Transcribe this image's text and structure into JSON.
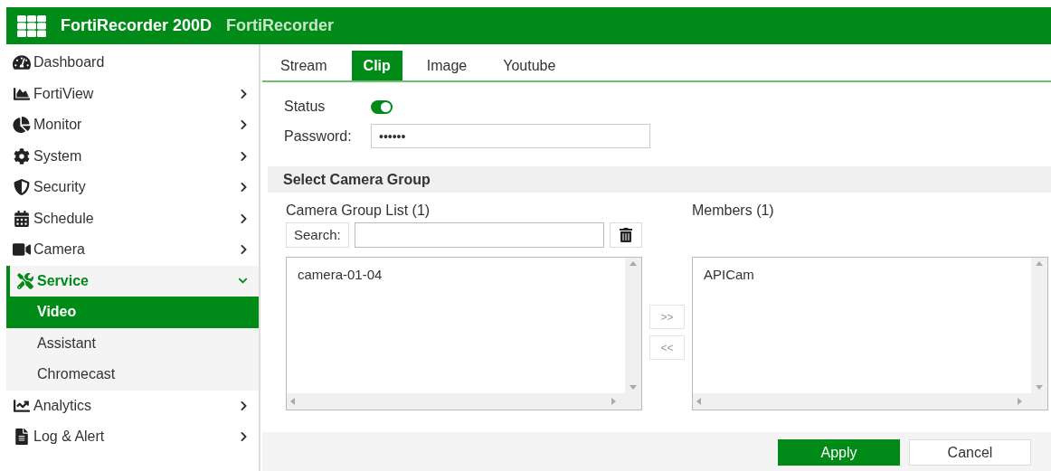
{
  "header": {
    "product": "FortiRecorder 200D",
    "hostname": "FortiRecorder"
  },
  "sidebar": {
    "items": [
      {
        "label": "Dashboard",
        "selected": false
      },
      {
        "label": "FortiView",
        "selected": false,
        "expanded": false
      },
      {
        "label": "Monitor",
        "selected": false,
        "expanded": false
      },
      {
        "label": "System",
        "selected": false,
        "expanded": false
      },
      {
        "label": "Security",
        "selected": false,
        "expanded": false
      },
      {
        "label": "Schedule",
        "selected": false,
        "expanded": false
      },
      {
        "label": "Camera",
        "selected": false,
        "expanded": false
      },
      {
        "label": "Service",
        "selected": true,
        "expanded": true,
        "children": [
          {
            "label": "Video",
            "selected": true
          },
          {
            "label": "Assistant",
            "selected": false
          },
          {
            "label": "Chromecast",
            "selected": false
          }
        ]
      },
      {
        "label": "Analytics",
        "selected": false,
        "expanded": false
      },
      {
        "label": "Log & Alert",
        "selected": false,
        "expanded": false
      }
    ]
  },
  "tabs": [
    {
      "label": "Stream",
      "selected": false
    },
    {
      "label": "Clip",
      "selected": true
    },
    {
      "label": "Image",
      "selected": false
    },
    {
      "label": "Youtube",
      "selected": false
    }
  ],
  "form": {
    "status": {
      "label": "Status",
      "on": true
    },
    "password": {
      "label": "Password:",
      "value": "••••••"
    }
  },
  "section": {
    "title": "Select Camera Group",
    "available": {
      "label": "Camera Group List (1)",
      "search_label": "Search:",
      "items": [
        "camera-01-04"
      ]
    },
    "move_buttons": [
      ">>",
      "<<"
    ],
    "members": {
      "label": "Members (1)",
      "items": [
        "APICam"
      ]
    }
  },
  "buttons": [
    {
      "label": "Apply",
      "kind": "primary"
    },
    {
      "label": "Cancel",
      "kind": "secondary"
    }
  ]
}
